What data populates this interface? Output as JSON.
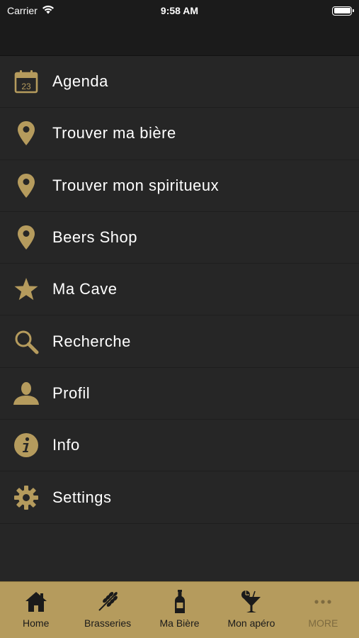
{
  "status_bar": {
    "carrier": "Carrier",
    "time": "9:58 AM"
  },
  "theme": {
    "accent": "#b59b5d",
    "menu_background": "#262626",
    "header_background": "#1b1b1b"
  },
  "calendar_icon_day": "23",
  "menu": {
    "items": [
      {
        "label": "Agenda",
        "icon": "calendar-icon"
      },
      {
        "label": "Trouver ma bière",
        "icon": "location-pin-icon"
      },
      {
        "label": "Trouver mon spiritueux",
        "icon": "location-pin-icon"
      },
      {
        "label": "Beers Shop",
        "icon": "location-pin-icon"
      },
      {
        "label": "Ma Cave",
        "icon": "star-icon"
      },
      {
        "label": "Recherche",
        "icon": "search-icon"
      },
      {
        "label": "Profil",
        "icon": "person-icon"
      },
      {
        "label": "Info",
        "icon": "info-icon"
      },
      {
        "label": "Settings",
        "icon": "gear-icon"
      }
    ]
  },
  "tabbar": {
    "tabs": [
      {
        "label": "Home",
        "icon": "home-icon"
      },
      {
        "label": "Brasseries",
        "icon": "wheat-icon"
      },
      {
        "label": "Ma Bière",
        "icon": "beer-bottle-icon"
      },
      {
        "label": "Mon apéro",
        "icon": "cocktail-icon"
      },
      {
        "label": "MORE",
        "icon": "more-icon"
      }
    ]
  }
}
